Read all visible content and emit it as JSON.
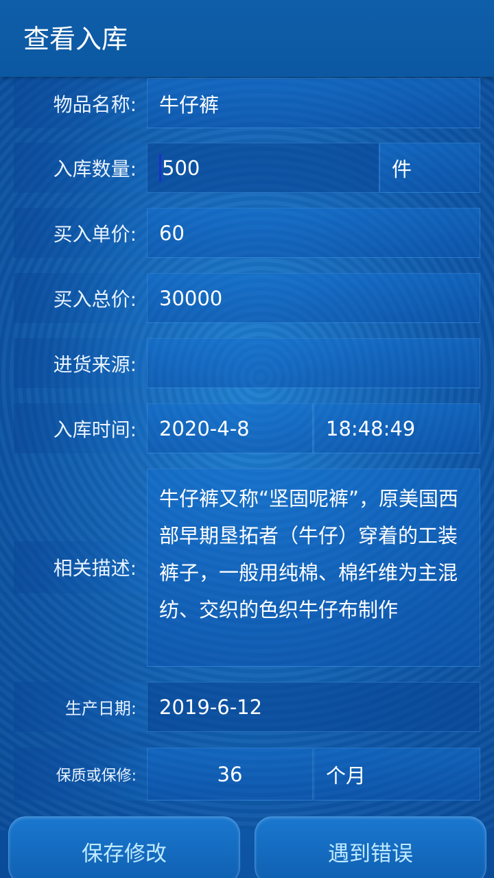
{
  "header": {
    "title": "查看入库"
  },
  "form": {
    "name": {
      "label": "物品名称:",
      "value": "牛仔裤"
    },
    "quantity": {
      "label": "入库数量:",
      "value": "500",
      "unit": "件"
    },
    "unit_price": {
      "label": "买入单价:",
      "value": "60"
    },
    "total_price": {
      "label": "买入总价:",
      "value": "30000"
    },
    "source": {
      "label": "进货来源:",
      "value": ""
    },
    "time": {
      "label": "入库时间:",
      "date": "2020-4-8",
      "clock": "18:48:49"
    },
    "description": {
      "label": "相关描述:",
      "value": "牛仔裤又称“坚固呢裤”，原美国西部早期垦拓者（牛仔）穿着的工装裤子，一般用纯棉、棉纤维为主混纺、交织的色织牛仔布制作"
    },
    "production_date": {
      "label": "生产日期:",
      "value": "2019-6-12"
    },
    "warranty": {
      "label": "保质或保修:",
      "value": "36",
      "unit": "个月"
    }
  },
  "buttons": {
    "save": "保存修改",
    "error": "遇到错误"
  }
}
